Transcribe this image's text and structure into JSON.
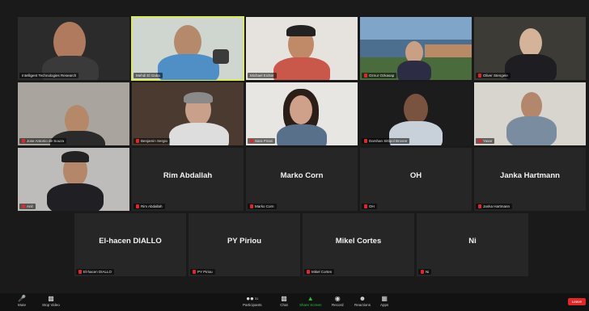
{
  "participants_row1": [
    {
      "name": "Intelligent Technologies Research",
      "muted": false
    },
    {
      "name": "Mehdi El Gaba",
      "muted": false
    },
    {
      "name": "Michael Eicher",
      "muted": false
    },
    {
      "name": "Oznur Ozkasap",
      "muted": true
    },
    {
      "name": "Oliver Stengele",
      "muted": true
    }
  ],
  "participants_row2": [
    {
      "name": "Jose Antonio de Souza",
      "muted": true
    },
    {
      "name": "Benjamin Sergio",
      "muted": true
    },
    {
      "name": "Sara Pirani",
      "muted": true
    },
    {
      "name": "Darshan Sittipol Brovee",
      "muted": true
    },
    {
      "name": "Yasar",
      "muted": true
    }
  ],
  "participants_row3": [
    {
      "name": "Anil",
      "display": "",
      "muted": true
    },
    {
      "name": "Rim Abdallah",
      "display": "Rim Abdallah",
      "muted": true
    },
    {
      "name": "Marko Corn",
      "display": "Marko Corn",
      "muted": true
    },
    {
      "name": "OH",
      "display": "OH",
      "muted": true
    },
    {
      "name": "Janka Hartmann",
      "display": "Janka Hartmann",
      "muted": true
    }
  ],
  "participants_row4": [
    {
      "name": "El-hacen DIALLO",
      "display": "El-hacen DIALLO",
      "muted": true
    },
    {
      "name": "PY Piriou",
      "display": "PY Piriou",
      "muted": true
    },
    {
      "name": "Mikel Cortes",
      "display": "Mikel Cortes",
      "muted": true
    },
    {
      "name": "Ni",
      "display": "Ni",
      "muted": true
    }
  ],
  "toolbar": {
    "mute": "Mute",
    "stop_video": "Stop Video",
    "participants": "Participants",
    "participants_count": "31",
    "chat": "Chat",
    "share_screen": "Share Screen",
    "record": "Record",
    "reactions": "Reactions",
    "apps": "Apps",
    "leave": "Leave"
  },
  "colors": {
    "mic_off": "#e0262b",
    "share_green": "#25c03a",
    "leave_red": "#e02828",
    "active_speaker": "#d9e66a"
  }
}
